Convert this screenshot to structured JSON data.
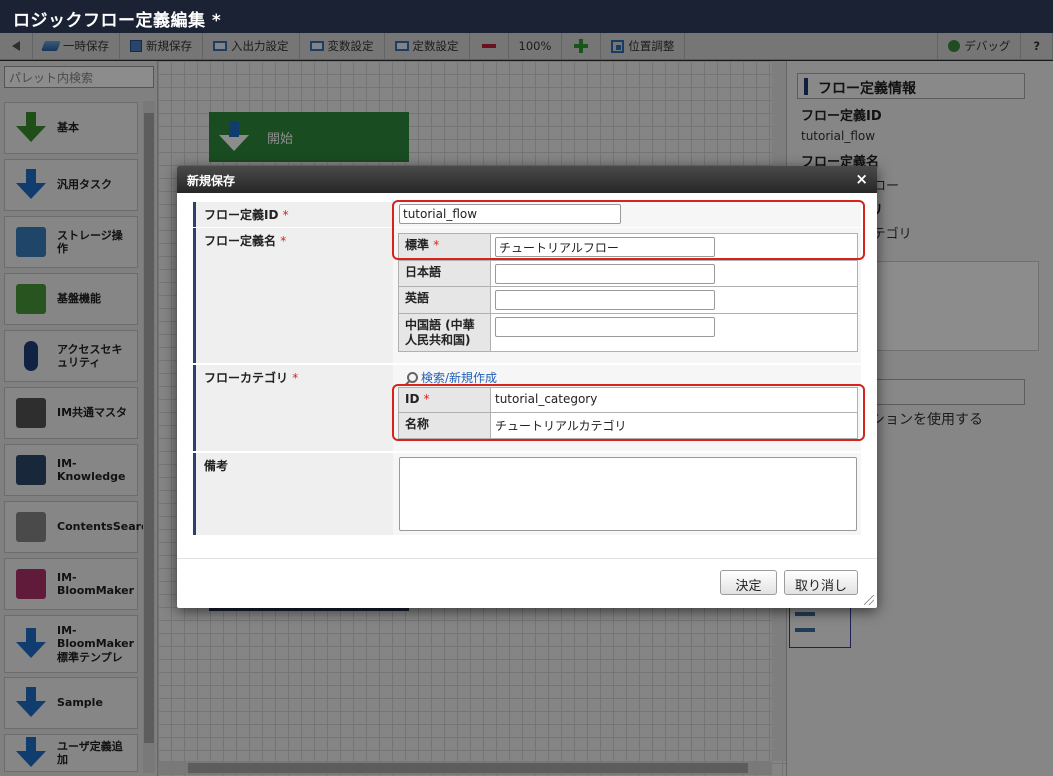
{
  "app": {
    "title": "ロジックフロー定義編集 *"
  },
  "toolbar": {
    "temp_save": "一時保存",
    "new_save": "新規保存",
    "io_settings": "入出力設定",
    "var_settings": "変数設定",
    "const_settings": "定数設定",
    "zoom": "100%",
    "position": "位置調整",
    "debug": "デバッグ",
    "help": "?"
  },
  "palette": {
    "search_placeholder": "パレット内検索",
    "items": [
      {
        "label": "基本",
        "icon": "arrow-down-green-icon"
      },
      {
        "label": "汎用タスク",
        "icon": "arrow-down-blue-icon"
      },
      {
        "label": "ストレージ操作",
        "icon": "storage-icon"
      },
      {
        "label": "基盤機能",
        "icon": "grid-icon"
      },
      {
        "label": "アクセスセキュリティ",
        "icon": "key-icon"
      },
      {
        "label": "IM共通マスタ",
        "icon": "database-icon"
      },
      {
        "label": "IM-Knowledge",
        "icon": "bookshelf-icon"
      },
      {
        "label": "ContentsSearch",
        "icon": "search-doc-icon"
      },
      {
        "label": "IM-BloomMaker",
        "icon": "bloom-icon"
      },
      {
        "label": "IM-BloomMaker標準テンプレ",
        "icon": "arrow-down-blue-icon"
      },
      {
        "label": "Sample",
        "icon": "arrow-down-blue-icon"
      },
      {
        "label": "ユーザ定義追加",
        "icon": "arrow-down-plus-icon"
      }
    ]
  },
  "canvas": {
    "start_label": "開始"
  },
  "right_panel": {
    "header": "フロー定義情報",
    "id_label": "フロー定義ID",
    "id_value": "tutorial_flow",
    "name_label": "フロー定義名",
    "name_value": "ルフロー",
    "category_label": "ゴリ",
    "category_value": "ルカテゴリ",
    "btn_label": "定",
    "btn_text": "クションを使用する"
  },
  "dialog": {
    "title": "新規保存",
    "close": "×",
    "required_mark": "*",
    "flow_id_label": "フロー定義ID",
    "flow_id_value": "tutorial_flow",
    "flow_name_label": "フロー定義名",
    "names": [
      {
        "lang": "標準",
        "value": "チュートリアルフロー",
        "required": true
      },
      {
        "lang": "日本語",
        "value": ""
      },
      {
        "lang": "英語",
        "value": ""
      },
      {
        "lang": "中国語 (中華人民共和国)",
        "value": ""
      }
    ],
    "category_label": "フローカテゴリ",
    "search_link": "検索/新規作成",
    "category": {
      "id_label": "ID",
      "id_value": "tutorial_category",
      "name_label": "名称",
      "name_value": "チュートリアルカテゴリ"
    },
    "remarks_label": "備考",
    "remarks_value": "",
    "ok_button": "決定",
    "cancel_button": "取り消し"
  }
}
